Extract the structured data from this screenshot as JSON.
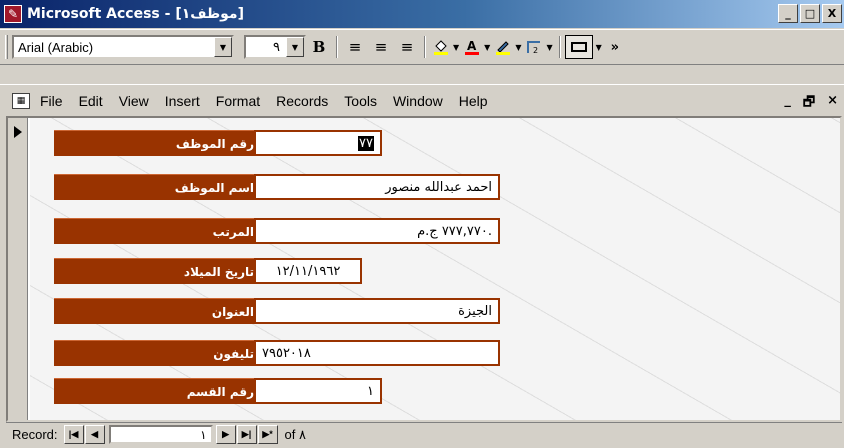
{
  "window": {
    "title": "Microsoft Access - [موظف١]",
    "buttons": [
      "_",
      "□",
      "X"
    ]
  },
  "toolbar": {
    "font_name": "Arial (Arabic)",
    "font_size": "٩",
    "bold_label": "B",
    "align_left": "≡",
    "align_center": "≡",
    "align_right": "≡",
    "fill_color": "#ffff00",
    "font_color": "#ff0000",
    "line_color": "#ffff00",
    "more": "»"
  },
  "menu": {
    "items": [
      "File",
      "Edit",
      "View",
      "Insert",
      "Format",
      "Records",
      "Tools",
      "Window",
      "Help"
    ],
    "right_controls": [
      "_",
      "🗗",
      "×"
    ]
  },
  "form": {
    "fields": [
      {
        "label": "رقم الموظف",
        "value": "٧٧"
      },
      {
        "label": "اسم الموظف",
        "value": "احمد عبدالله منصور"
      },
      {
        "label": "المرتب",
        "value": "٧٧٧,٧٧٠ ج.م."
      },
      {
        "label": "تاريخ الميلاد",
        "value": "١٢/١١/١٩٦٢"
      },
      {
        "label": "العنوان",
        "value": "الجيزة"
      },
      {
        "label": "تليفون",
        "value": "٧٩٥٢٠١٨"
      },
      {
        "label": "رقم القسم",
        "value": "١"
      }
    ],
    "accent_color": "#993300"
  },
  "navigator": {
    "label": "Record:",
    "current": "١",
    "of_text": "of",
    "total": "٨"
  }
}
